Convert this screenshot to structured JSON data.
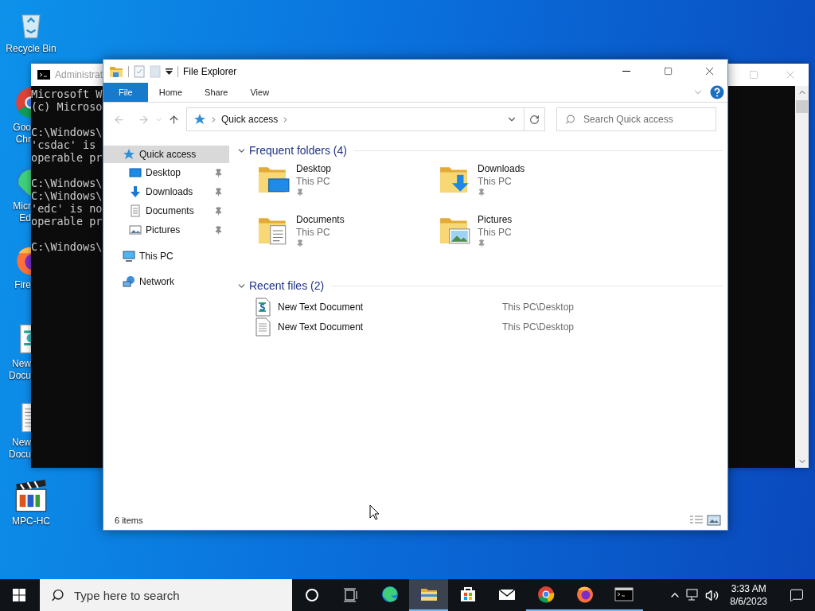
{
  "desktop_icons": [
    {
      "kind": "recycle-bin",
      "lines": [
        "Recycle Bin"
      ],
      "covered": false
    },
    {
      "kind": "chrome",
      "lines": [
        "Goo",
        "Chr"
      ],
      "covered": true
    },
    {
      "kind": "edge",
      "lines": [
        "Micr",
        "Ed"
      ],
      "covered": true
    },
    {
      "kind": "firefox",
      "lines": [
        "Fire"
      ],
      "covered": true
    },
    {
      "kind": "script-doc",
      "lines": [
        "New",
        "Docu"
      ],
      "covered": true
    },
    {
      "kind": "text-doc",
      "lines": [
        "New",
        "Docu"
      ],
      "covered": true
    },
    {
      "kind": "mpc",
      "lines": [
        "MPC-HC"
      ],
      "covered": false
    }
  ],
  "console_window": {
    "title": "Administrat",
    "blocks": [
      [
        "Microsoft W",
        "(c) Microso"
      ],
      [
        "C:\\Windows\\",
        "'csdac' is",
        "operable pr"
      ],
      [
        "C:\\Windows\\",
        "C:\\Windows\\",
        "'edc' is no",
        "operable pr"
      ],
      [
        "C:\\Windows\\"
      ]
    ]
  },
  "explorer": {
    "title": "File Explorer",
    "ribbon_tabs": [
      {
        "label": "File",
        "selected": true
      },
      {
        "label": "Home",
        "selected": false
      },
      {
        "label": "Share",
        "selected": false
      },
      {
        "label": "View",
        "selected": false
      }
    ],
    "address": {
      "path": "Quick access"
    },
    "search": {
      "placeholder": "Search Quick access"
    },
    "nav": [
      {
        "label": "Quick access",
        "kind": "quick",
        "selected": true,
        "pinned": false,
        "children": [
          {
            "label": "Desktop",
            "kind": "desktop",
            "selected": false,
            "pinned": true
          },
          {
            "label": "Downloads",
            "kind": "downloads",
            "selected": false,
            "pinned": true
          },
          {
            "label": "Documents",
            "kind": "documents",
            "selected": false,
            "pinned": true
          },
          {
            "label": "Pictures",
            "kind": "pictures",
            "selected": false,
            "pinned": true
          }
        ]
      },
      {
        "label": "This PC",
        "kind": "pc",
        "selected": false,
        "pinned": false
      },
      {
        "label": "Network",
        "kind": "network",
        "selected": false,
        "pinned": false
      }
    ],
    "sections": [
      {
        "title": "Frequent folders (4)",
        "kind": "folders",
        "expanded": true,
        "items": [
          {
            "name": "Desktop",
            "location": "This PC",
            "kind": "desktop",
            "pinned": true
          },
          {
            "name": "Downloads",
            "location": "This PC",
            "kind": "downloads",
            "pinned": true
          },
          {
            "name": "Documents",
            "location": "This PC",
            "kind": "documents",
            "pinned": true
          },
          {
            "name": "Pictures",
            "location": "This PC",
            "kind": "pictures",
            "pinned": true
          }
        ]
      },
      {
        "title": "Recent files (2)",
        "kind": "files",
        "expanded": true,
        "items": [
          {
            "name": "New Text Document",
            "location": "This PC\\Desktop",
            "kind": "script"
          },
          {
            "name": "New Text Document",
            "location": "This PC\\Desktop",
            "kind": "text"
          }
        ]
      }
    ],
    "status": "6 items"
  },
  "taskbar": {
    "search": {
      "placeholder": "Type here to search"
    },
    "apps": [
      {
        "kind": "edge",
        "running": false,
        "selected": false
      },
      {
        "kind": "explorer",
        "running": true,
        "selected": true
      },
      {
        "kind": "store",
        "running": false,
        "selected": false
      },
      {
        "kind": "mail",
        "running": false,
        "selected": false
      },
      {
        "kind": "chrome",
        "running": true,
        "selected": false
      },
      {
        "kind": "firefox",
        "running": true,
        "selected": false
      },
      {
        "kind": "terminal",
        "running": true,
        "selected": false
      }
    ],
    "time": "3:33 AM",
    "date": "8/6/2023"
  }
}
